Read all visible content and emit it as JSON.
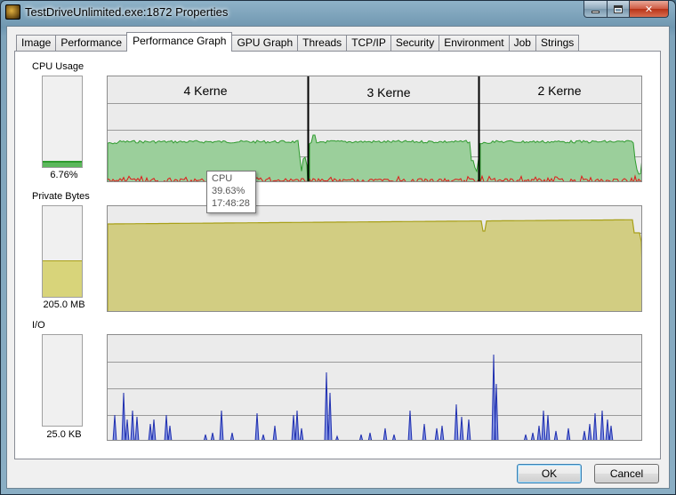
{
  "window": {
    "title": "TestDriveUnlimited.exe:1872 Properties"
  },
  "tabs": [
    "Image",
    "Performance",
    "Performance Graph",
    "GPU Graph",
    "Threads",
    "TCP/IP",
    "Security",
    "Environment",
    "Job",
    "Strings"
  ],
  "active_tab": "Performance Graph",
  "cpu": {
    "label": "CPU Usage",
    "value": "6.76%",
    "fill_fraction": 0.0676,
    "color": "#2f9b2f",
    "segments": [
      "4 Kerne",
      "3 Kerne",
      "2 Kerne"
    ]
  },
  "tooltip": {
    "title": "CPU",
    "value": "39.63%",
    "time": "17:48:28"
  },
  "private_bytes": {
    "label": "Private Bytes",
    "value": "205.0 MB",
    "fill_fraction": 0.4,
    "color": "#a8a018"
  },
  "io": {
    "label": "I/O",
    "value": "25.0  KB",
    "fill_fraction": 0.0
  },
  "buttons": {
    "ok": "OK",
    "cancel": "Cancel"
  }
}
